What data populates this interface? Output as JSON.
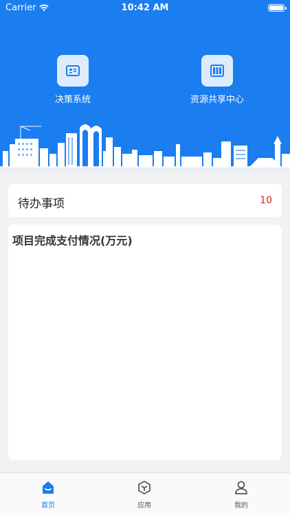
{
  "status_bar": {
    "carrier": "Carrier",
    "time": "10:42 AM"
  },
  "shortcuts": [
    {
      "label": "决策系统",
      "icon": "decision-system-icon"
    },
    {
      "label": "资源共享中心",
      "icon": "resource-sharing-icon"
    }
  ],
  "todo": {
    "label": "待办事项",
    "count": "10"
  },
  "panel": {
    "title": "项目完成支付情况(万元)"
  },
  "tabbar": {
    "items": [
      {
        "label": "首页",
        "icon": "home-icon",
        "active": true
      },
      {
        "label": "应用",
        "icon": "apps-icon",
        "active": false
      },
      {
        "label": "我的",
        "icon": "user-icon",
        "active": false
      }
    ]
  },
  "colors": {
    "primary": "#1a7df0",
    "count_red": "#e01b1b",
    "background": "#f1f2f4"
  }
}
